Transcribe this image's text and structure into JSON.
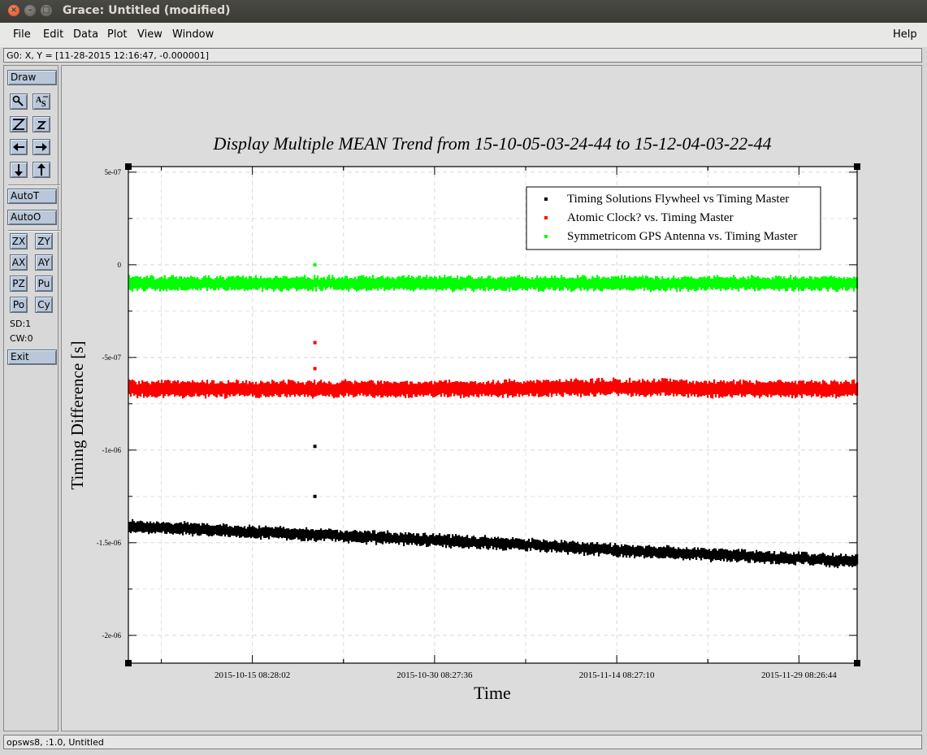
{
  "window": {
    "title": "Grace: Untitled (modified)",
    "close_label": "×",
    "min_label": "–",
    "max_label": "□"
  },
  "menu": {
    "items": [
      "File",
      "Edit",
      "Data",
      "Plot",
      "View",
      "Window"
    ],
    "help": "Help"
  },
  "locator": "G0: X, Y = [11-28-2015 12:16:47, -0.000001]",
  "toolbar": {
    "draw": "Draw",
    "autot": "AutoT",
    "autoo": "AutoO",
    "zx": "ZX",
    "zy": "ZY",
    "ax": "AX",
    "ay": "AY",
    "pz": "PZ",
    "pu": "Pu",
    "po": "Po",
    "cy": "Cy",
    "sd": "SD:1",
    "cw": "CW:0",
    "exit": "Exit",
    "icons": [
      "zoom-magnifier-icon",
      "text-label-icon",
      "zoom-big-z-icon",
      "zoom-small-z-icon",
      "arrow-left-icon",
      "arrow-right-icon",
      "arrow-down-icon",
      "arrow-up-icon"
    ]
  },
  "status": "opsws8, :1.0, Untitled",
  "chart_data": {
    "type": "scatter",
    "title": "Display Multiple MEAN Trend from 15-10-05-03-24-44 to 15-12-04-03-22-44",
    "xlabel": "Time",
    "ylabel": "Timing Difference [s]",
    "x_ticks": [
      "2015-10-15 08:28:02",
      "2015-10-30 08:27:36",
      "2015-11-14 08:27:10",
      "2015-11-29 08:26:44"
    ],
    "y_ticks": [
      "5e-07",
      "0",
      "-5e-07",
      "-1e-06",
      "-1.5e-06",
      "-2e-06"
    ],
    "ylim": [
      -2.15e-06,
      5.3e-07
    ],
    "xlim": [
      "2015-10-05 03:24:44",
      "2015-12-04 03:22:44"
    ],
    "legend_position": "top-right",
    "grid": true,
    "series": [
      {
        "name": "Timing Solutions Flywheel vs Timing Master",
        "color": "#000000",
        "x": [
          "2015-10-05",
          "2015-10-15",
          "2015-10-25",
          "2015-11-04",
          "2015-11-14",
          "2015-11-24",
          "2015-12-04"
        ],
        "y": [
          -1.41e-06,
          -1.44e-06,
          -1.47e-06,
          -1.5e-06,
          -1.54e-06,
          -1.57e-06,
          -1.6e-06
        ],
        "band": 6e-08,
        "outliers": [
          {
            "x": "2015-10-20 12:00:00",
            "y": -9.8e-07
          },
          {
            "x": "2015-10-20 12:00:00",
            "y": -1.25e-06
          }
        ]
      },
      {
        "name": "Atomic Clock? vs. Timing Master",
        "color": "#ff0000",
        "x": [
          "2015-10-05",
          "2015-10-15",
          "2015-10-25",
          "2015-11-04",
          "2015-11-14",
          "2015-11-24",
          "2015-12-04"
        ],
        "y": [
          -6.7e-07,
          -6.7e-07,
          -6.7e-07,
          -6.7e-07,
          -6.6e-07,
          -6.7e-07,
          -6.7e-07
        ],
        "band": 8e-08,
        "outliers": [
          {
            "x": "2015-10-20 12:00:00",
            "y": -4.2e-07
          },
          {
            "x": "2015-10-20 12:00:00",
            "y": -5.6e-07
          }
        ]
      },
      {
        "name": "Symmetricom GPS Antenna vs. Timing Master",
        "color": "#00ff00",
        "x": [
          "2015-10-05",
          "2015-10-15",
          "2015-10-25",
          "2015-11-04",
          "2015-11-14",
          "2015-11-24",
          "2015-12-04"
        ],
        "y": [
          -1e-07,
          -1e-07,
          -1e-07,
          -1e-07,
          -1e-07,
          -1e-07,
          -1e-07
        ],
        "band": 7e-08,
        "outliers": [
          {
            "x": "2015-10-20 12:00:00",
            "y": 0
          }
        ]
      }
    ]
  }
}
